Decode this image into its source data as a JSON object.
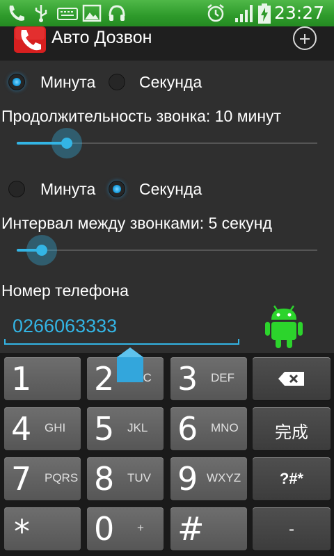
{
  "status_bar": {
    "time": "23:27",
    "icons": [
      "phone-icon",
      "usb-icon",
      "keyboard-icon",
      "image-icon",
      "headset-icon",
      "alarm-icon",
      "signal-icon",
      "battery-charging-icon"
    ],
    "color": "#2e9a2b"
  },
  "action_bar": {
    "title": "Авто Дозвон",
    "app_icon": "phone-app-icon",
    "action_icon": "add-circle-icon"
  },
  "duration": {
    "radio_minute": "Минута",
    "radio_second": "Секунда",
    "selected": "Минута",
    "label": "Продолжительность звонка: 10 минут",
    "slider_value_fraction": 0.17
  },
  "interval": {
    "radio_minute": "Минута",
    "radio_second": "Секунда",
    "selected": "Секунда",
    "label": "Интервал между звонками: 5 секунд",
    "slider_value_fraction": 0.08
  },
  "phone": {
    "label": "Номер телефона",
    "value": "0266063333",
    "side_icon": "android-robot-icon"
  },
  "keyboard": {
    "keys": [
      {
        "main": "1",
        "sub": ""
      },
      {
        "main": "2",
        "sub": "ABC"
      },
      {
        "main": "3",
        "sub": "DEF"
      },
      {
        "main": "",
        "sub": "",
        "icon": "backspace-icon"
      },
      {
        "main": "4",
        "sub": "GHI"
      },
      {
        "main": "5",
        "sub": "JKL"
      },
      {
        "main": "6",
        "sub": "MNO"
      },
      {
        "main": "完成",
        "sub": ""
      },
      {
        "main": "7",
        "sub": "PQRS"
      },
      {
        "main": "8",
        "sub": "TUV"
      },
      {
        "main": "9",
        "sub": "WXYZ"
      },
      {
        "main": "?#*",
        "sub": ""
      },
      {
        "main": "*",
        "sub": ""
      },
      {
        "main": "0",
        "sub": "+"
      },
      {
        "main": "#",
        "sub": ""
      },
      {
        "main": "-",
        "sub": ""
      }
    ]
  },
  "colors": {
    "accent": "#33b5e5",
    "content_bg": "#2f2f2f",
    "android_green": "#2cd42c"
  }
}
